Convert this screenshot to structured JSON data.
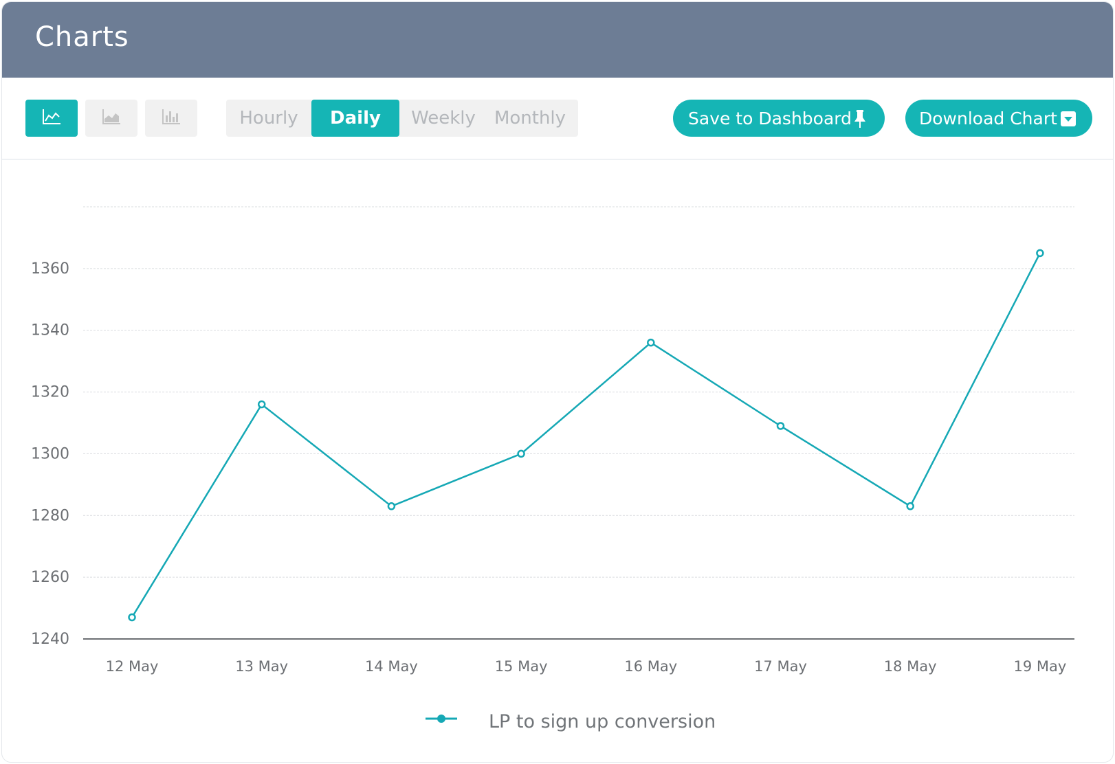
{
  "header": {
    "title": "Charts"
  },
  "toolbar": {
    "chart_types": [
      {
        "icon": "line-chart-icon",
        "active": true
      },
      {
        "icon": "area-chart-icon",
        "active": false
      },
      {
        "icon": "bar-chart-icon",
        "active": false
      }
    ],
    "intervals": [
      "Hourly",
      "Daily",
      "Weekly",
      "Monthly"
    ],
    "selected_interval": "Daily",
    "save_label": "Save to Dashboard",
    "save_icon": "pin-icon",
    "download_label": "Download Chart",
    "download_icon": "caret-down-icon",
    "accent_color": "#15b5b5",
    "header_color": "#6d7d95"
  },
  "chart_data": {
    "type": "line",
    "x": [
      "12 May",
      "13 May",
      "14 May",
      "15 May",
      "16 May",
      "17 May",
      "18 May",
      "19 May"
    ],
    "series": [
      {
        "name": "LP to sign up conversion",
        "values": [
          1247,
          1316,
          1283,
          1300,
          1336,
          1309,
          1283,
          1365
        ],
        "color": "#15a8b5"
      }
    ],
    "yticks": [
      1240,
      1260,
      1280,
      1300,
      1320,
      1340,
      1360
    ],
    "ylim": [
      1240,
      1380
    ],
    "grid": true,
    "legend_position": "bottom-center"
  }
}
